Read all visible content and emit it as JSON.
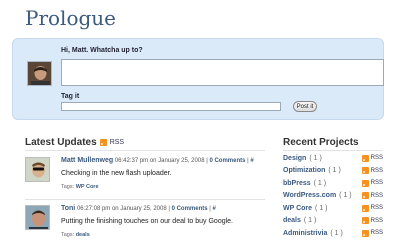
{
  "site": {
    "title": "Prologue"
  },
  "post_form": {
    "prompt": "Hi, Matt. Whatcha up to?",
    "textarea_value": "",
    "tag_label": "Tag it",
    "tag_value": "",
    "submit_label": "Post it"
  },
  "updates_section": {
    "title": "Latest Updates",
    "rss_label": "RSS"
  },
  "updates": [
    {
      "author": "Matt Mullenweg",
      "time": "06:42:37 pm on January 25, 2008",
      "comments": "0 Comments",
      "permalink": "#",
      "message": "Checking in the new flash uploader.",
      "tags_label": "Tags:",
      "tags": "WP Core"
    },
    {
      "author": "Toni",
      "time": "06:27:08 pm on January 25, 2008",
      "comments": "0 Comments",
      "permalink": "#",
      "message": "Putting the finishing touches on our deal to buy Google.",
      "tags_label": "Tags:",
      "tags": "deals"
    }
  ],
  "projects_section": {
    "title": "Recent Projects"
  },
  "projects": [
    {
      "name": "Design",
      "count": "( 1 )",
      "rss": "RSS"
    },
    {
      "name": "Optimization",
      "count": "( 1 )",
      "rss": "RSS"
    },
    {
      "name": "bbPress",
      "count": "( 1 )",
      "rss": "RSS"
    },
    {
      "name": "WordPress.com",
      "count": "( 1 )",
      "rss": "RSS"
    },
    {
      "name": "WP Core",
      "count": "( 1 )",
      "rss": "RSS"
    },
    {
      "name": "deals",
      "count": "( 1 )",
      "rss": "RSS"
    },
    {
      "name": "Administrivia",
      "count": "( 1 )",
      "rss": "RSS"
    }
  ],
  "colors": {
    "link": "#3a5a7e",
    "post_box_bg": "#dbeaf9",
    "rss": "#f7921e"
  }
}
